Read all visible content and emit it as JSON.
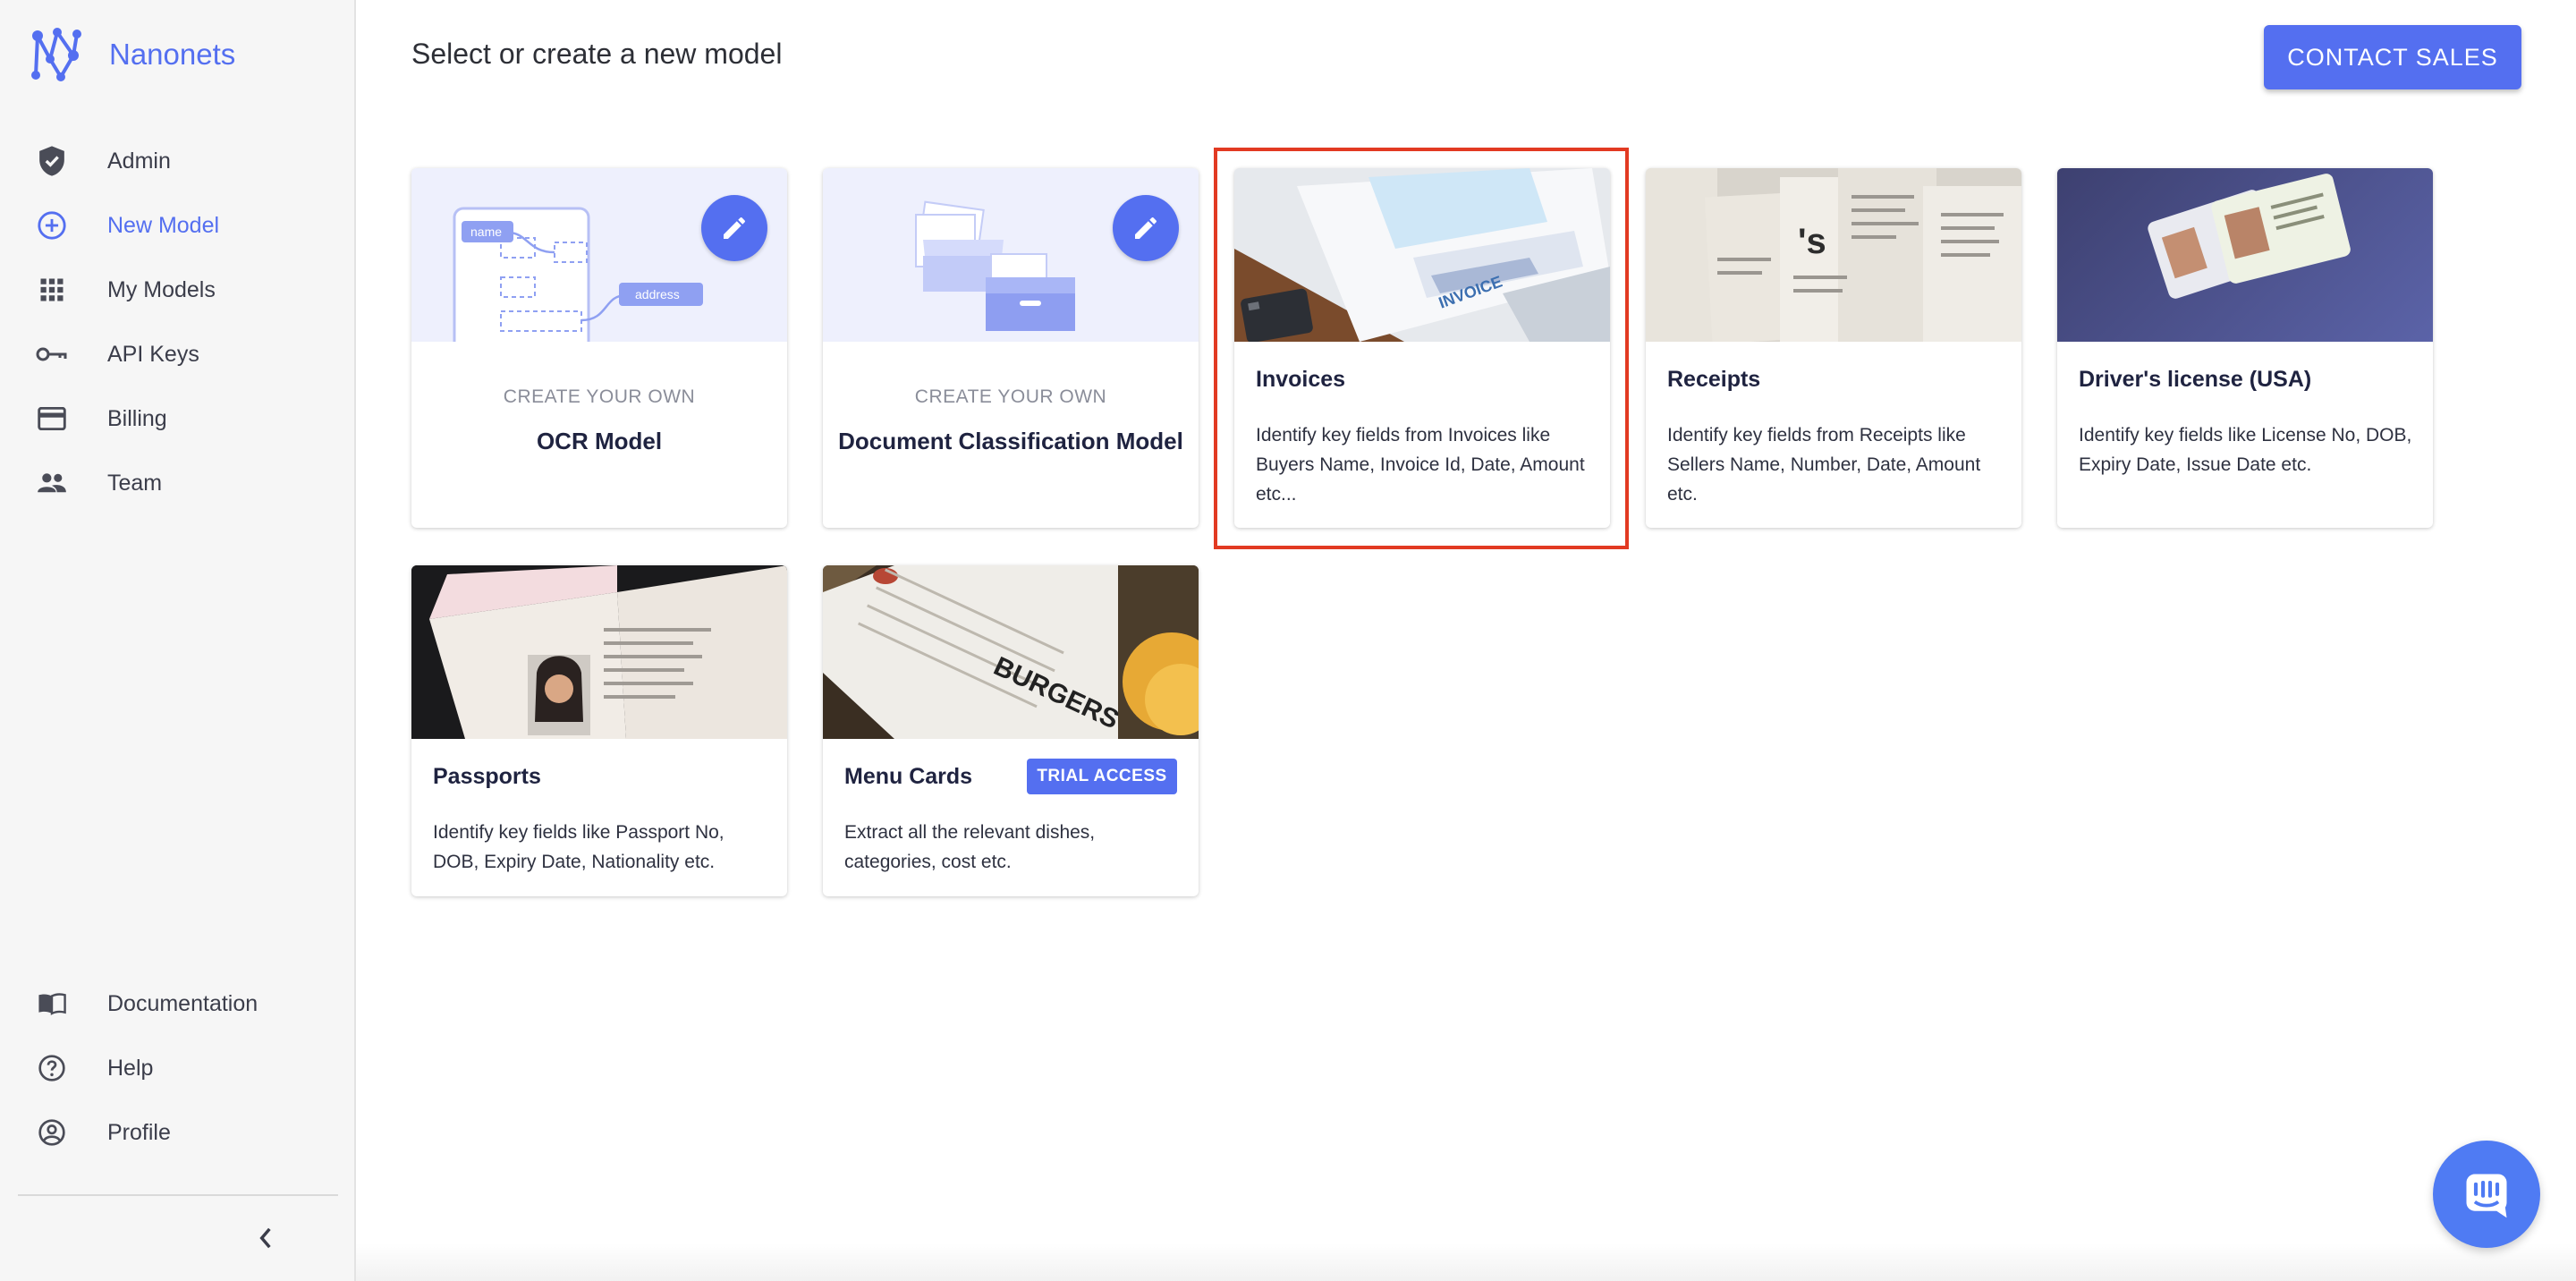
{
  "brand": {
    "name": "Nanonets"
  },
  "sidebar": {
    "items": [
      {
        "label": "Admin",
        "icon": "shield-check-icon"
      },
      {
        "label": "New Model",
        "icon": "plus-circle-icon",
        "active": true
      },
      {
        "label": "My Models",
        "icon": "grid-icon"
      },
      {
        "label": "API Keys",
        "icon": "key-icon"
      },
      {
        "label": "Billing",
        "icon": "credit-card-icon"
      },
      {
        "label": "Team",
        "icon": "people-icon"
      }
    ],
    "bottom_items": [
      {
        "label": "Documentation",
        "icon": "book-icon"
      },
      {
        "label": "Help",
        "icon": "help-circle-icon"
      },
      {
        "label": "Profile",
        "icon": "user-circle-icon"
      }
    ]
  },
  "header": {
    "title": "Select or create a new model",
    "contact_button": "CONTACT SALES"
  },
  "cards": [
    {
      "kind": "create",
      "label": "CREATE YOUR OWN",
      "title": "OCR Model",
      "diagram_tags": [
        "name",
        "address"
      ]
    },
    {
      "kind": "create",
      "label": "CREATE YOUR OWN",
      "title": "Document Classification Model"
    },
    {
      "kind": "template",
      "title": "Invoices",
      "description": "Identify key fields from Invoices like Buyers Name, Invoice Id, Date, Amount etc...",
      "selected": true
    },
    {
      "kind": "template",
      "title": "Receipts",
      "description": "Identify key fields from Receipts like Sellers Name, Number, Date, Amount etc."
    },
    {
      "kind": "template",
      "title": "Driver's license (USA)",
      "description": "Identify key fields like License No, DOB, Expiry Date, Issue Date etc."
    },
    {
      "kind": "template",
      "title": "Passports",
      "description": "Identify key fields like Passport No, DOB, Expiry Date, Nationality etc."
    },
    {
      "kind": "template",
      "title": "Menu Cards",
      "description": "Extract all the relevant dishes, categories, cost etc.",
      "badge": "TRIAL ACCESS"
    }
  ],
  "colors": {
    "accent": "#546ff0",
    "highlight": "#e23a22",
    "chat": "#4f7bf3"
  }
}
